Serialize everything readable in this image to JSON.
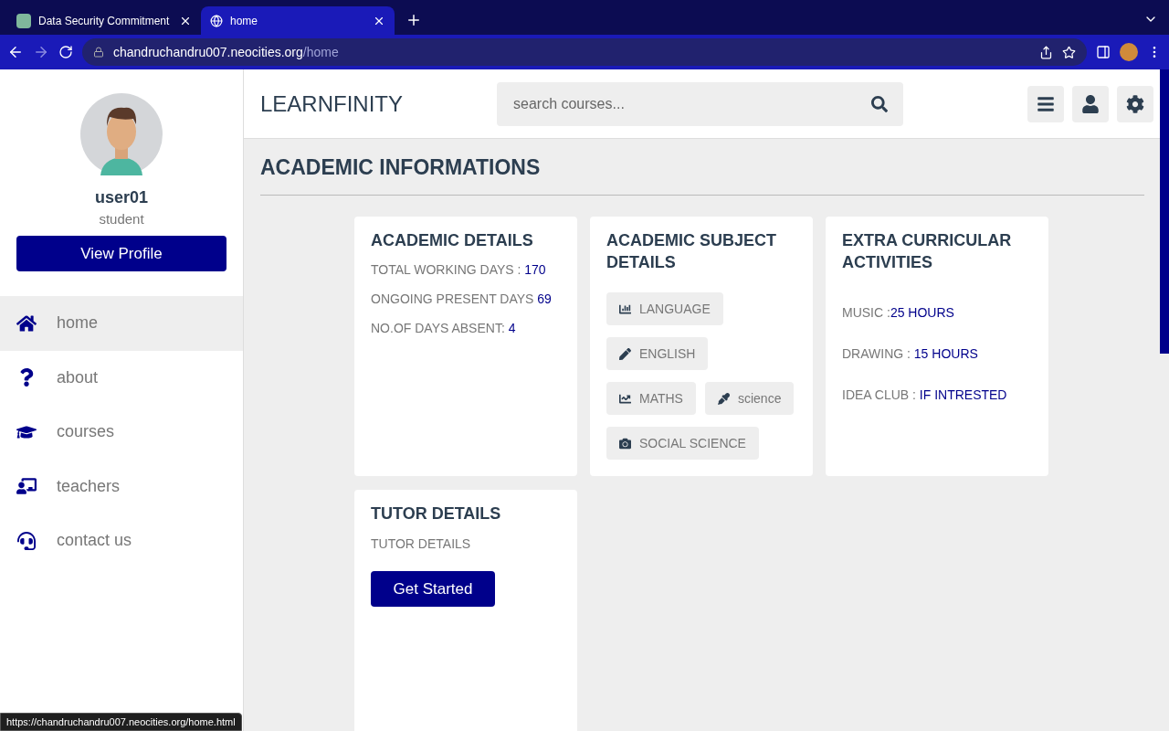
{
  "browser": {
    "tabs": [
      {
        "title": "Data Security Commitment",
        "kind": "app",
        "selected": false
      },
      {
        "title": "home",
        "kind": "globe",
        "selected": true
      }
    ],
    "url": {
      "host": "chandruchandru007.neocities.org",
      "path": "/home"
    },
    "status_url": "https://chandruchandru007.neocities.org/home.html"
  },
  "sidebar": {
    "profile": {
      "name": "user01",
      "role": "student",
      "button": "View Profile"
    },
    "nav": [
      {
        "label": "home",
        "kind": "home",
        "selected": true
      },
      {
        "label": "about",
        "kind": "question",
        "selected": false
      },
      {
        "label": "courses",
        "kind": "cap",
        "selected": false
      },
      {
        "label": "teachers",
        "kind": "teacher",
        "selected": false
      },
      {
        "label": "contact us",
        "kind": "headset",
        "selected": false
      }
    ]
  },
  "header": {
    "logo": "LEARNFINITY",
    "search": {
      "placeholder": "search courses..."
    }
  },
  "page_title": "ACADEMIC INFORMATIONS",
  "cards": [
    {
      "kind": "lines",
      "title": "ACADEMIC DETAILS",
      "lines": [
        {
          "label": "TOTAL WORKING DAYS : ",
          "value": "170"
        },
        {
          "label": "ONGOING PRESENT DAYS ",
          "value": "69"
        },
        {
          "label": "NO.OF DAYS ABSENT: ",
          "value": "4"
        }
      ]
    },
    {
      "kind": "chips",
      "title": "ACADEMIC SUBJECT DETAILS",
      "chip_rows": [
        [
          {
            "label": "LANGUAGE",
            "kind": "bars"
          }
        ],
        [
          {
            "label": "ENGLISH",
            "kind": "pen"
          }
        ],
        [
          {
            "label": "MATHS",
            "kind": "line"
          },
          {
            "label": "science",
            "kind": "dropper"
          }
        ],
        [
          {
            "label": "SOCIAL SCIENCE",
            "kind": "camera"
          }
        ]
      ]
    },
    {
      "kind": "spaced",
      "title": "EXTRA CURRICULAR ACTIVITIES",
      "lines": [
        {
          "label": "MUSIC :",
          "value": "25 HOURS"
        },
        {
          "label": "DRAWING : ",
          "value": "15 HOURS"
        },
        {
          "label": "IDEA CLUB : ",
          "value": "IF INTRESTED"
        }
      ]
    },
    {
      "kind": "tutor",
      "title": "TUTOR DETAILS",
      "text": "TUTOR DETAILS",
      "button": "Get Started"
    }
  ]
}
